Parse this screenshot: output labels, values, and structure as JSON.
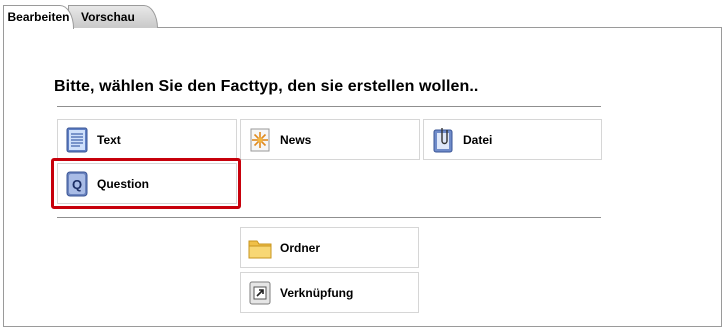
{
  "tabs": [
    {
      "label": "Bearbeiten",
      "active": true
    },
    {
      "label": "Vorschau",
      "active": false
    }
  ],
  "heading": "Bitte, wählen Sie den Facttyp, den sie erstellen wollen..",
  "fact_types": [
    {
      "label": "Text",
      "icon": "text-document-icon"
    },
    {
      "label": "News",
      "icon": "news-sparkle-icon"
    },
    {
      "label": "Datei",
      "icon": "file-paperclip-icon"
    },
    {
      "label": "Question",
      "icon": "question-q-icon",
      "highlighted": true
    }
  ],
  "other_types": [
    {
      "label": "Ordner",
      "icon": "folder-icon"
    },
    {
      "label": "Verknüpfung",
      "icon": "link-shortcut-icon"
    }
  ],
  "colors": {
    "highlight": "#c7000b",
    "border": "#d6d6d6",
    "icon_blue": "#6a86c8",
    "folder_yellow": "#f3c64e"
  }
}
